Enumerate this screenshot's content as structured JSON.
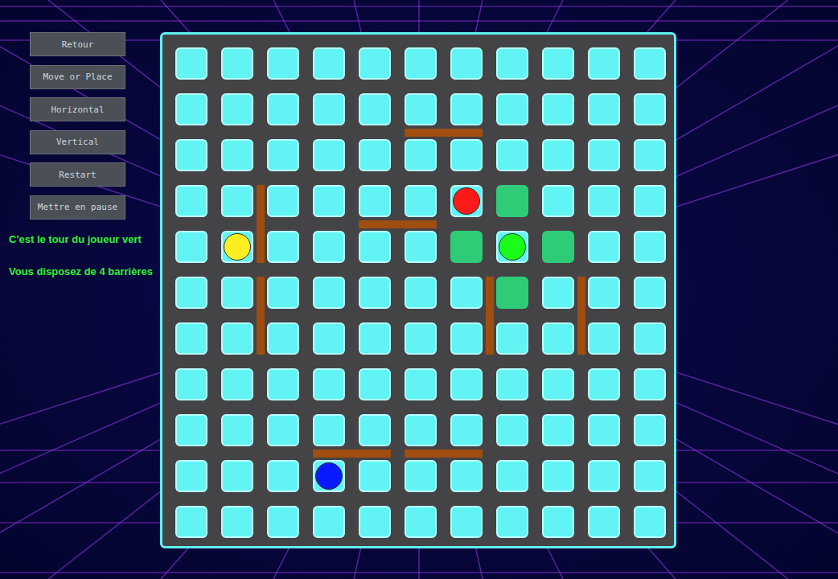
{
  "buttons": [
    {
      "label": "Retour"
    },
    {
      "label": "Move or Place"
    },
    {
      "label": "Horizontal"
    },
    {
      "label": "Vertical"
    },
    {
      "label": "Restart"
    },
    {
      "label": "Mettre en pause"
    }
  ],
  "status": {
    "turn": "C'est le tour du joueur vert",
    "walls_left": "Vous disposez de 4 barrières",
    "color": "#33ee33"
  },
  "board": {
    "size": 11,
    "pieces": [
      {
        "player": "red",
        "color": "#ff1a1a",
        "col": 6,
        "row": 3
      },
      {
        "player": "green",
        "color": "#1aff1a",
        "col": 7,
        "row": 4
      },
      {
        "player": "yellow",
        "color": "#ffee22",
        "col": 1,
        "row": 4
      },
      {
        "player": "blue",
        "color": "#0a1aff",
        "col": 3,
        "row": 9
      }
    ],
    "highlights": [
      {
        "col": 7,
        "row": 3
      },
      {
        "col": 6,
        "row": 4
      },
      {
        "col": 8,
        "row": 4
      },
      {
        "col": 7,
        "row": 5
      }
    ],
    "walls": [
      {
        "orientation": "horizontal",
        "col": 5,
        "row": 1
      },
      {
        "orientation": "vertical",
        "col": 1,
        "row": 3
      },
      {
        "orientation": "horizontal",
        "col": 4,
        "row": 3
      },
      {
        "orientation": "vertical",
        "col": 1,
        "row": 5
      },
      {
        "orientation": "vertical",
        "col": 6,
        "row": 5
      },
      {
        "orientation": "vertical",
        "col": 8,
        "row": 5
      },
      {
        "orientation": "horizontal",
        "col": 3,
        "row": 8
      },
      {
        "orientation": "horizontal",
        "col": 5,
        "row": 8
      }
    ]
  }
}
